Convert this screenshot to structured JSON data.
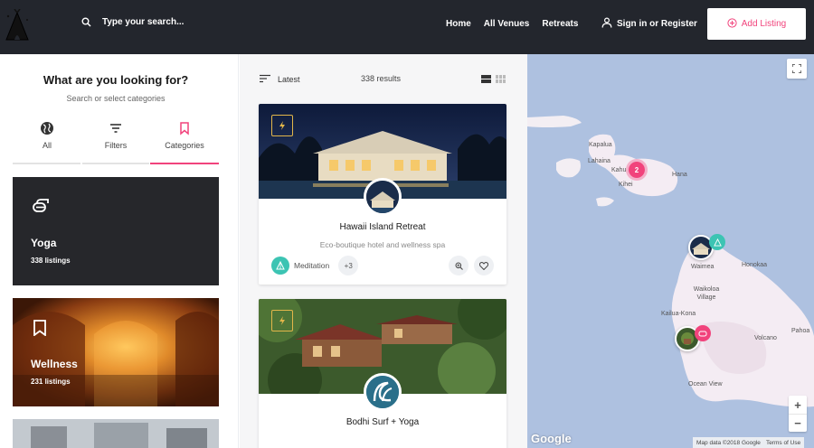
{
  "header": {
    "search_placeholder": "Type your search...",
    "nav": [
      "Home",
      "All Venues",
      "Retreats"
    ],
    "signin": "Sign in or Register",
    "add_listing": "Add Listing"
  },
  "sidebar": {
    "title": "What are you looking for?",
    "subtitle": "Search or select categories",
    "tabs": [
      {
        "label": "All",
        "icon": "globe-icon"
      },
      {
        "label": "Filters",
        "icon": "filter-icon"
      },
      {
        "label": "Categories",
        "icon": "bookmark-icon",
        "active": true
      }
    ],
    "categories": [
      {
        "name": "Yoga",
        "count": "338 listings",
        "icon": "yoga-mat-icon"
      },
      {
        "name": "Wellness",
        "count": "231 listings",
        "icon": "bookmark-icon"
      }
    ]
  },
  "listings": {
    "sort": "Latest",
    "results": "338 results",
    "items": [
      {
        "name": "Hawaii Island Retreat",
        "description": "Eco-boutique hotel and wellness spa",
        "tag": "Meditation",
        "more": "+3"
      },
      {
        "name": "Bodhi Surf + Yoga"
      }
    ]
  },
  "map": {
    "cluster_count": "2",
    "places": [
      "Kapalua",
      "Lahaina",
      "Kahu",
      "Kihei",
      "Hana",
      "Waimea",
      "Honokaa",
      "Waikoloa Village",
      "Kailua-Kona",
      "Volcano",
      "Pahoa",
      "Ocean View"
    ],
    "google": "Google",
    "map_data": "Map data ©2018 Google",
    "terms": "Terms of Use"
  },
  "colors": {
    "header_bg": "#23262d",
    "accent": "#f1437c",
    "teal": "#3cc4b3",
    "gold": "#e2b64a"
  }
}
